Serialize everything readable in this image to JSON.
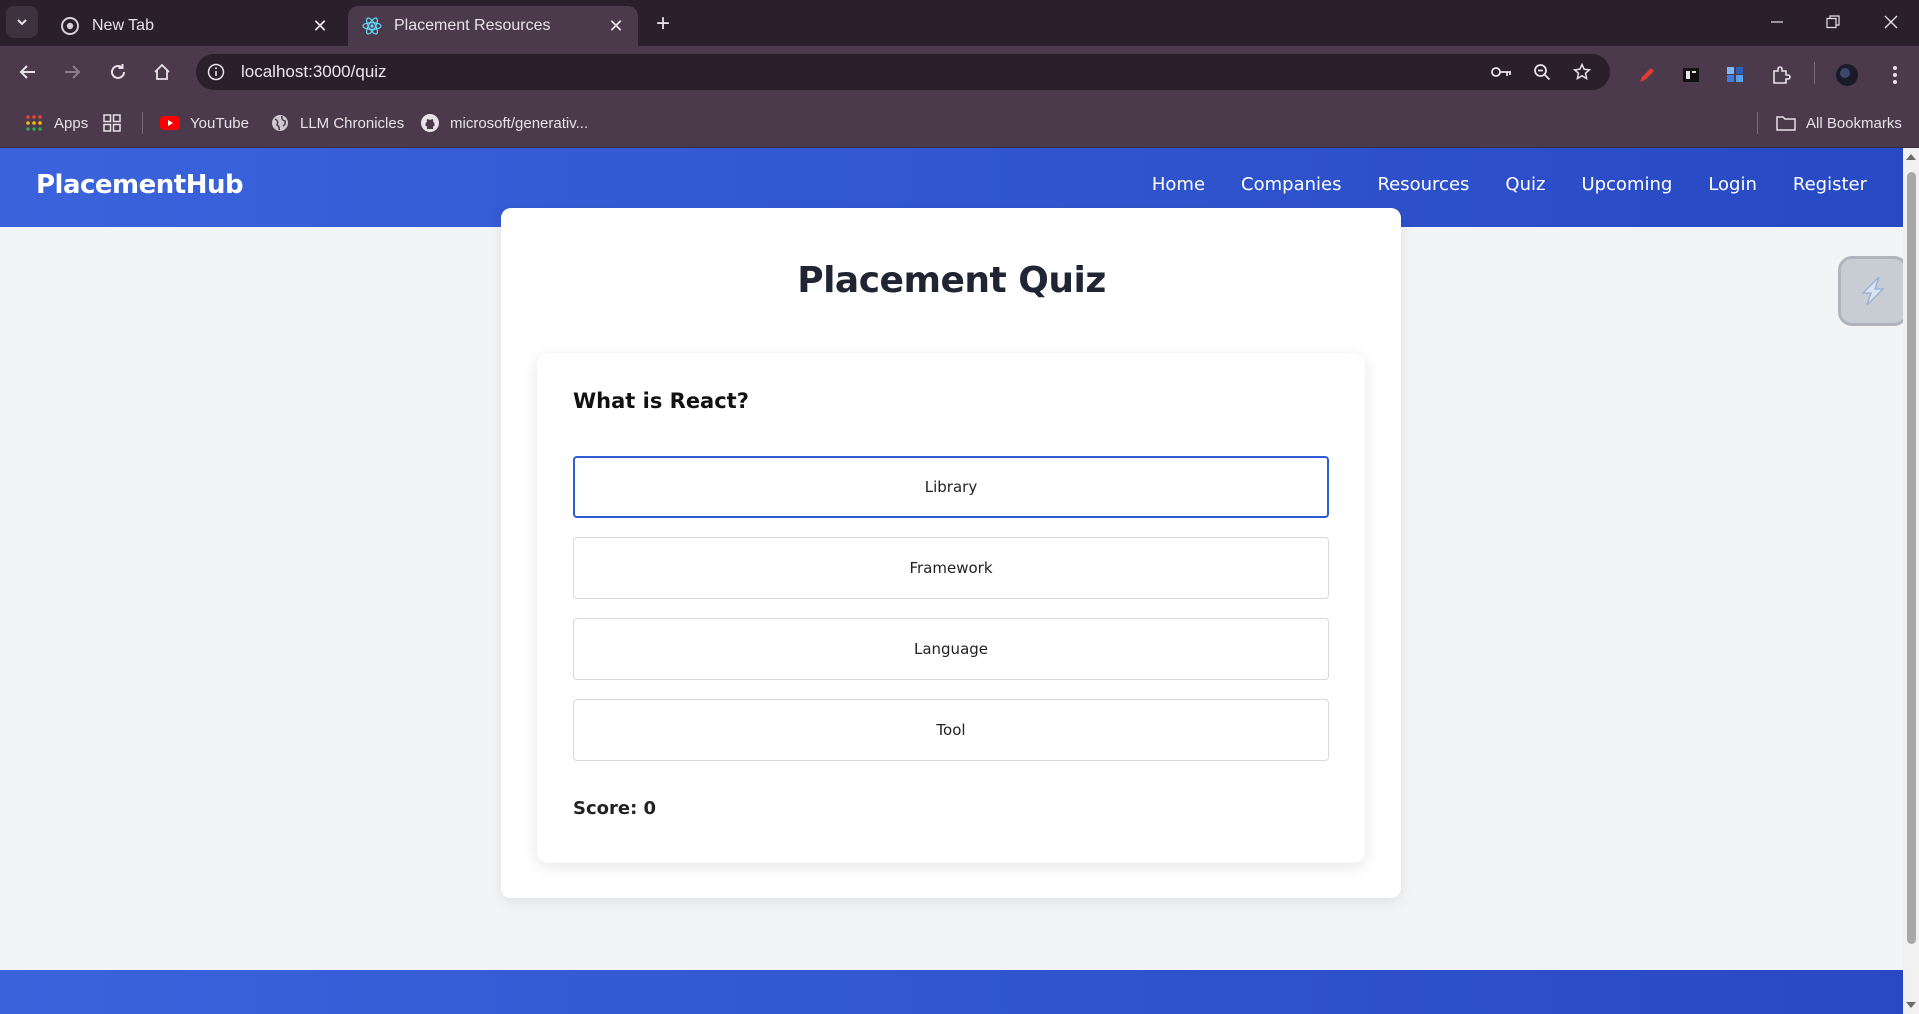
{
  "browser": {
    "tabs": [
      {
        "title": "New Tab",
        "icon": "chrome-icon",
        "active": false
      },
      {
        "title": "Placement Resources",
        "icon": "react-icon",
        "active": true
      }
    ],
    "url": "localhost:3000/quiz",
    "bookmarks": [
      {
        "label": "Apps",
        "icon": "apps-grid-icon"
      },
      {
        "label": "",
        "icon": "tab-groups-icon"
      },
      {
        "label": "YouTube",
        "icon": "youtube-icon"
      },
      {
        "label": "LLM Chronicles",
        "icon": "globe-icon"
      },
      {
        "label": "microsoft/generativ...",
        "icon": "github-icon"
      }
    ],
    "all_bookmarks_label": "All Bookmarks"
  },
  "header": {
    "brand": "PlacementHub",
    "nav": [
      "Home",
      "Companies",
      "Resources",
      "Quiz",
      "Upcoming",
      "Login",
      "Register"
    ]
  },
  "quiz": {
    "title": "Placement Quiz",
    "question": "What is React?",
    "options": [
      "Library",
      "Framework",
      "Language",
      "Tool"
    ],
    "selected_option": "Library",
    "score_label": "Score: 0"
  },
  "colors": {
    "header_gradient_start": "#3a63dc",
    "header_gradient_end": "#2849c4",
    "selected_border": "#2f5bd3",
    "page_background": "#f3f4f6",
    "chrome_dark": "#2b1f2b",
    "chrome_toolbar": "#4a3a4b"
  }
}
